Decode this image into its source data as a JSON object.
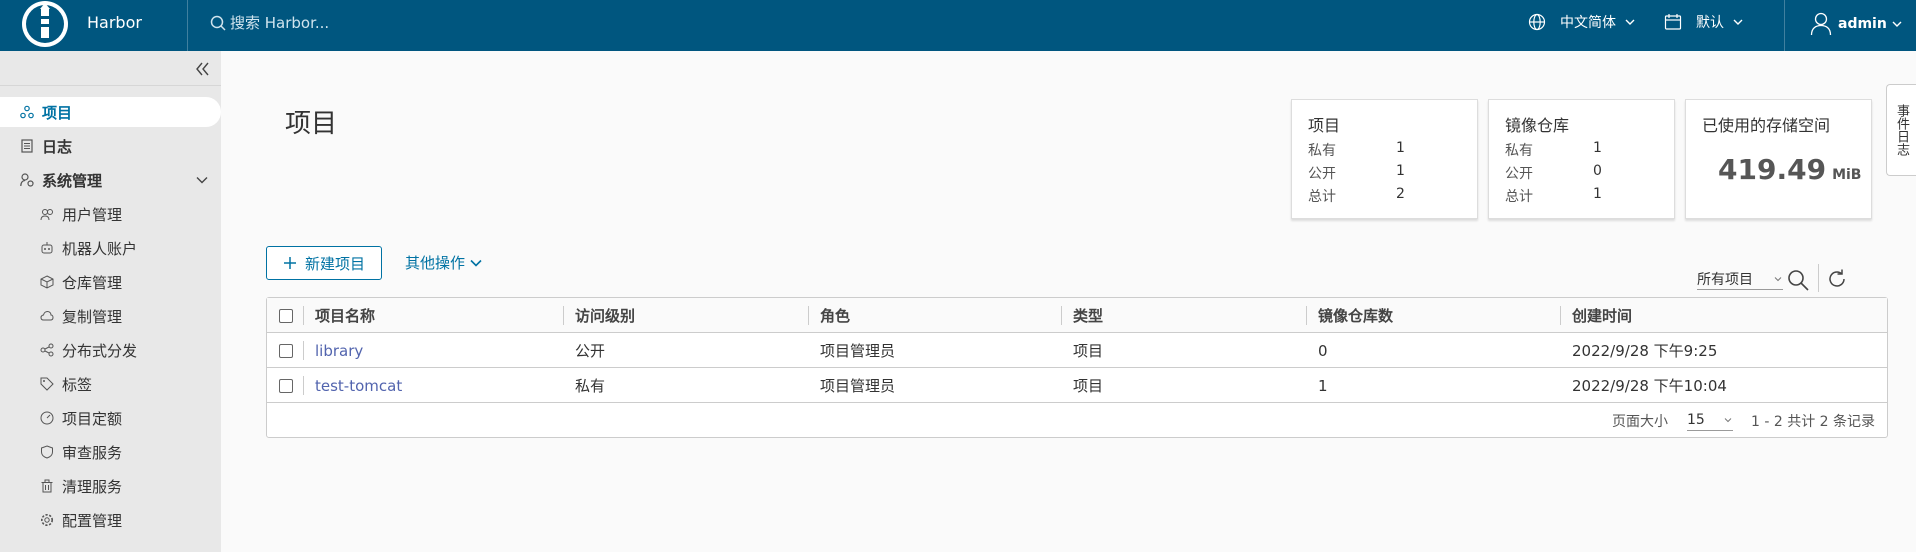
{
  "app": {
    "brand": "Harbor",
    "accent": "#0072a3",
    "header_bg": "#00567f"
  },
  "header": {
    "search_placeholder": "搜索 Harbor...",
    "language": "中文简体",
    "theme": "默认",
    "user": "admin"
  },
  "sidebar": {
    "items": [
      {
        "label": "项目",
        "icon": "projects-icon"
      },
      {
        "label": "日志",
        "icon": "logs-icon"
      },
      {
        "label": "系统管理",
        "icon": "admin-icon"
      }
    ],
    "sub_items": [
      {
        "label": "用户管理",
        "icon": "users-icon"
      },
      {
        "label": "机器人账户",
        "icon": "robot-icon"
      },
      {
        "label": "仓库管理",
        "icon": "registry-icon"
      },
      {
        "label": "复制管理",
        "icon": "replication-icon"
      },
      {
        "label": "分布式分发",
        "icon": "distribution-icon"
      },
      {
        "label": "标签",
        "icon": "tag-icon"
      },
      {
        "label": "项目定额",
        "icon": "quota-icon"
      },
      {
        "label": "审查服务",
        "icon": "scanner-icon"
      },
      {
        "label": "清理服务",
        "icon": "trash-icon"
      },
      {
        "label": "配置管理",
        "icon": "gear-icon"
      }
    ]
  },
  "main": {
    "title": "项目",
    "event_tab": "事件日志",
    "cards": {
      "projects": {
        "title": "项目",
        "rows": [
          {
            "k": "私有",
            "v": "1"
          },
          {
            "k": "公开",
            "v": "1"
          },
          {
            "k": "总计",
            "v": "2"
          }
        ]
      },
      "repos": {
        "title": "镜像仓库",
        "rows": [
          {
            "k": "私有",
            "v": "1"
          },
          {
            "k": "公开",
            "v": "0"
          },
          {
            "k": "总计",
            "v": "1"
          }
        ]
      },
      "storage": {
        "title": "已使用的存储空间",
        "value": "419.49",
        "unit": "MiB"
      }
    },
    "new_project": "新建项目",
    "more_actions": "其他操作",
    "filter": "所有项目"
  },
  "table": {
    "headers": [
      "项目名称",
      "访问级别",
      "角色",
      "类型",
      "镜像仓库数",
      "创建时间"
    ],
    "rows": [
      {
        "name": "library",
        "access": "公开",
        "role": "项目管理员",
        "type": "项目",
        "repos": "0",
        "created": "2022/9/28 下午9:25"
      },
      {
        "name": "test-tomcat",
        "access": "私有",
        "role": "项目管理员",
        "type": "项目",
        "repos": "1",
        "created": "2022/9/28 下午10:04"
      }
    ],
    "footer": {
      "page_size_label": "页面大小",
      "page_size": "15",
      "summary": "1 - 2 共计 2 条记录"
    }
  }
}
